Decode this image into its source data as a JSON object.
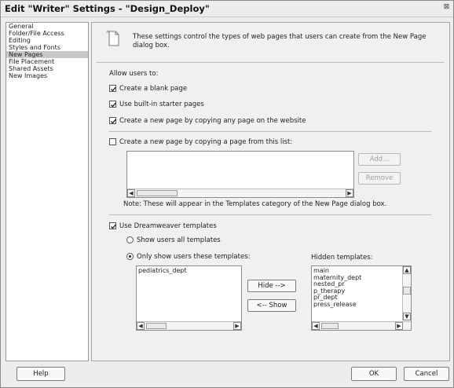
{
  "window": {
    "title": "Edit \"Writer\" Settings - \"Design_Deploy\"",
    "close_glyph": "⊠"
  },
  "categories": [
    {
      "label": "General"
    },
    {
      "label": "Folder/File Access"
    },
    {
      "label": "Editing"
    },
    {
      "label": "Styles and Fonts"
    },
    {
      "label": "New Pages",
      "selected": true
    },
    {
      "label": "File Placement"
    },
    {
      "label": "Shared Assets"
    },
    {
      "label": "New Images"
    }
  ],
  "panel": {
    "description_icon": "new-page-icon",
    "description": "These settings control the types of web pages that users can create from the New Page dialog box.",
    "allow_label": "Allow users to:",
    "create_blank": {
      "label": "Create a blank page",
      "checked": true
    },
    "use_starter": {
      "label": "Use built-in starter pages",
      "checked": true
    },
    "copy_any": {
      "label": "Create a new page by copying any page on the website",
      "checked": true
    },
    "copy_list": {
      "label": "Create a new page by copying a page from this list:",
      "checked": false
    },
    "add_label": "Add...",
    "remove_label": "Remove",
    "note": "Note: These will appear in the Templates category of the New Page dialog box.",
    "use_dw_templates": {
      "label": "Use Dreamweaver templates",
      "checked": true
    },
    "show_all": {
      "label": "Show users all templates",
      "selected": false
    },
    "only_show": {
      "label": "Only show users these templates:",
      "selected": true
    },
    "hidden_label": "Hidden templates:",
    "shown_templates": [
      "pediatrics_dept"
    ],
    "hidden_templates": [
      "main",
      "maternity_dept",
      "nested_pr",
      "p_therapy",
      "pr_dept",
      "press_release"
    ],
    "hide_button": "Hide -->",
    "show_button": "<-- Show"
  },
  "footer": {
    "help": "Help",
    "ok": "OK",
    "cancel": "Cancel"
  },
  "icons": {
    "scroll_left": "◀",
    "scroll_right": "▶",
    "scroll_up": "▲",
    "scroll_down": "▼"
  }
}
